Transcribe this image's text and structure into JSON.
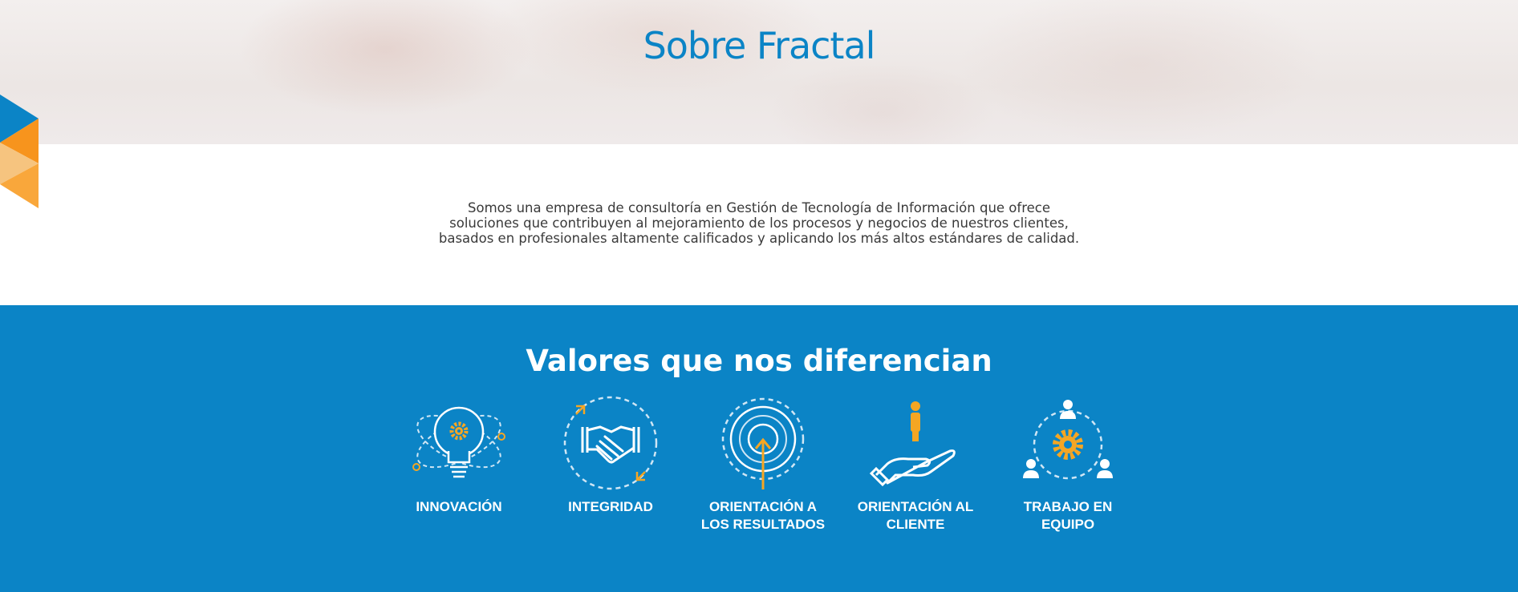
{
  "hero": {
    "title": "Sobre Fractal"
  },
  "intro": {
    "lines": [
      "Somos una empresa de consultoría en Gestión de Tecnología de Información que ofrece",
      "soluciones que contribuyen al mejoramiento de los procesos y negocios de nuestros clientes,",
      "basados en profesionales altamente calificados y aplicando los más altos estándares de calidad."
    ]
  },
  "values": {
    "title": "Valores que nos diferencian",
    "items": [
      {
        "label": "INNOVACIÓN",
        "icon": "lightbulb-gear-icon"
      },
      {
        "label": "INTEGRIDAD",
        "icon": "handshake-icon"
      },
      {
        "label": "ORIENTACIÓN A LOS RESULTADOS",
        "icon": "target-arrow-icon"
      },
      {
        "label": "ORIENTACIÓN AL CLIENTE",
        "icon": "hand-person-icon"
      },
      {
        "label": "TRABAJO EN EQUIPO",
        "icon": "team-gear-icon"
      }
    ]
  },
  "colors": {
    "brand_blue": "#0b84c6",
    "accent_orange": "#f5a623",
    "white": "#ffffff"
  }
}
